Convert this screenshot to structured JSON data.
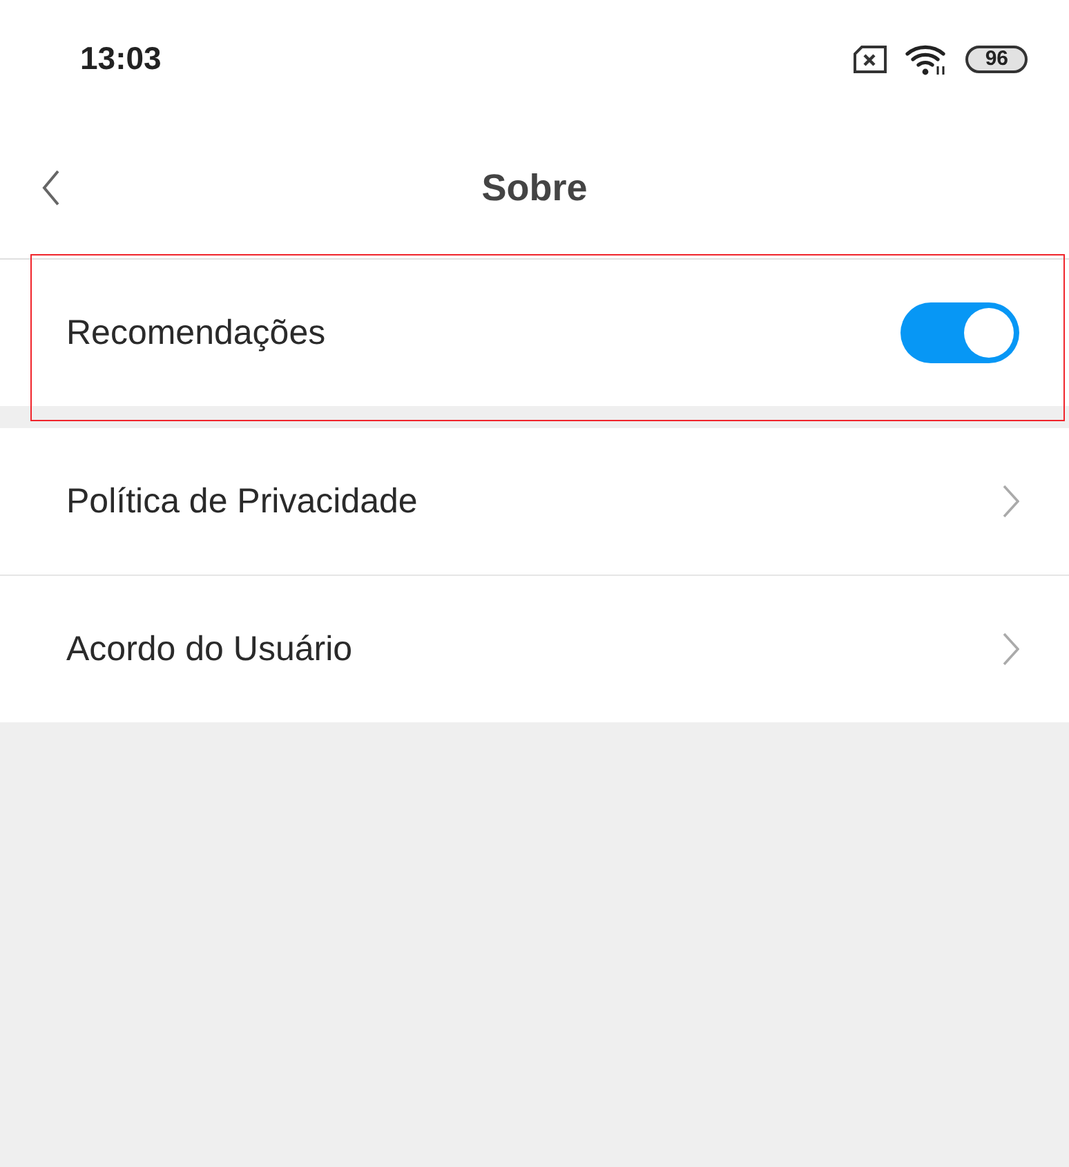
{
  "status_bar": {
    "time": "13:03",
    "battery": "96"
  },
  "header": {
    "title": "Sobre"
  },
  "sections": [
    {
      "items": [
        {
          "kind": "toggle",
          "label": "Recomendações",
          "on": true,
          "highlighted": true
        }
      ]
    },
    {
      "items": [
        {
          "kind": "link",
          "label": "Política de Privacidade",
          "highlighted": false
        },
        {
          "kind": "link",
          "label": "Acordo do Usuário",
          "highlighted": false
        }
      ]
    }
  ]
}
